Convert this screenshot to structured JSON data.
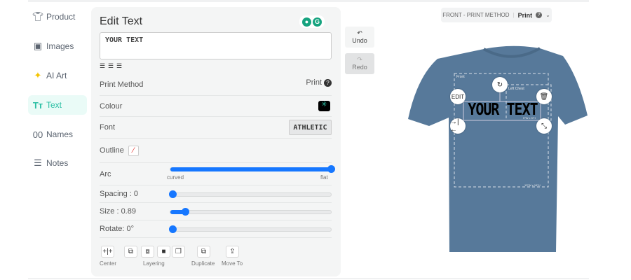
{
  "sidebar": {
    "items": [
      {
        "label": "Product",
        "icon": "tshirt-icon"
      },
      {
        "label": "Images",
        "icon": "image-icon"
      },
      {
        "label": "AI Art",
        "icon": "sparkle-icon"
      },
      {
        "label": "Text",
        "icon": "text-icon"
      },
      {
        "label": "Names",
        "icon": "numbers-icon"
      },
      {
        "label": "Notes",
        "icon": "lines-icon"
      }
    ]
  },
  "editor": {
    "title": "Edit Text",
    "text_value": "YOUR TEXT",
    "print_method_label": "Print Method",
    "print_method_value": "Print",
    "colour_label": "Colour",
    "colour_value": "#000000",
    "font_label": "Font",
    "font_value": "ATHLETIC",
    "outline_label": "Outline",
    "arc_label": "Arc",
    "arc_min": "curved",
    "arc_max": "flat",
    "arc_value": 1.0,
    "spacing_label": "Spacing : 0",
    "spacing_value": 0,
    "size_label": "Size : 0.89",
    "size_value": 0.09,
    "rotate_label": "Rotate: 0°",
    "rotate_value": 0,
    "center_label": "Center",
    "layering_label": "Layering",
    "duplicate_label": "Duplicate",
    "move_label": "Move To"
  },
  "history": {
    "undo": "Undo",
    "redo": "Redo"
  },
  "preview": {
    "view_label": "FRONT - PRINT METHOD",
    "view_value": "Print",
    "front_label": "Front",
    "left_chest_label": "Left Chest",
    "left_chest_size": "5\"W x 5\"H",
    "front_size": "13\"W x 16\"H",
    "design_text": "YOUR TEXT",
    "edit_label": "EDIT",
    "shirt_color": "#57799a"
  },
  "colors": {
    "accent": "#2bbfa4",
    "slider": "#1677ff"
  }
}
